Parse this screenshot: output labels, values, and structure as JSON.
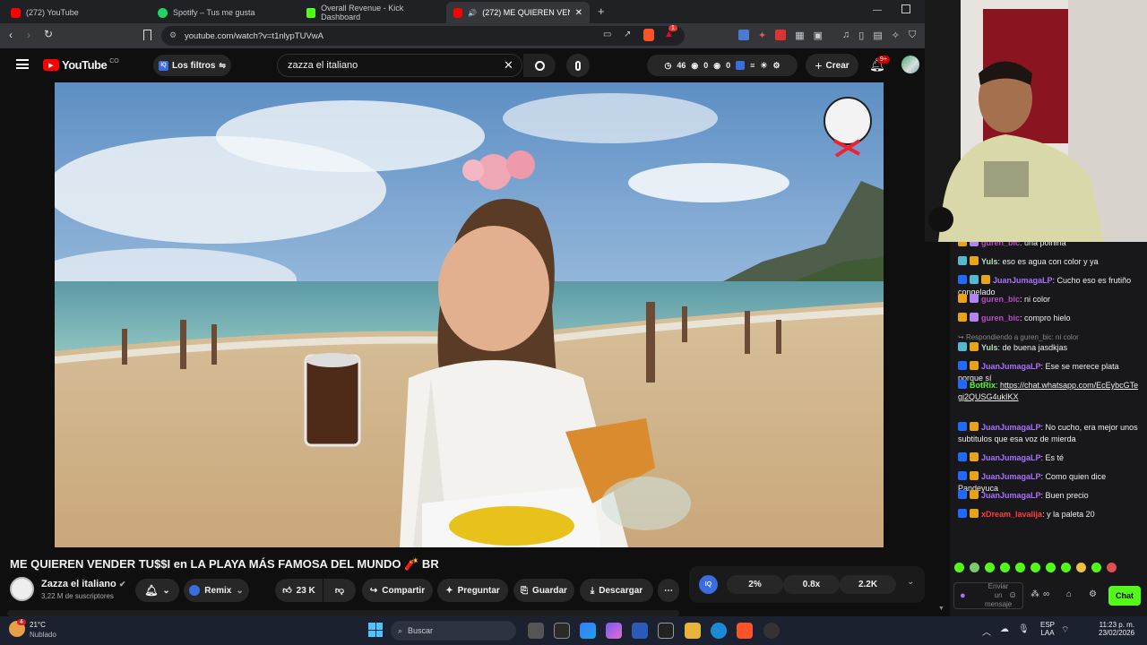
{
  "tabs": [
    {
      "label": "(272) YouTube",
      "color": "#ff0000"
    },
    {
      "label": "Spotify – Tus me gusta",
      "color": "#1ed760"
    },
    {
      "label": "Overall Revenue - Kick Dashboard",
      "color": "#53fc18"
    },
    {
      "label": "(272) ME QUIEREN VENDER T",
      "color": "#ff0000"
    }
  ],
  "url": "youtube.com/watch?v=t1nlypTUVwA",
  "ext_badge": "1",
  "yt": {
    "logo": "YouTube",
    "region": "CO",
    "filters": "Los filtros",
    "search_value": "zazza el italiano",
    "stats": [
      "46",
      "0",
      "0"
    ],
    "create": "Crear",
    "notif_count": "9+"
  },
  "video": {
    "title": "ME QUIEREN VENDER TU$$I en LA PLAYA MÁS FAMOSA DEL MUNDO 🧨 BR",
    "channel": "Zazza el italiano",
    "subs": "3,22 M de suscriptores",
    "remix": "Remix",
    "likes": "23 K",
    "share": "Compartir",
    "ask": "Preguntar",
    "save": "Guardar",
    "download": "Descargar"
  },
  "iq_stats": [
    "2%",
    "0.8x",
    "2.2K"
  ],
  "chat": {
    "messages": [
      {
        "user": "guren_bic",
        "color": "#b84cc8",
        "text": "una polnina",
        "badges": [
          "#e8a317",
          "#b084f6"
        ]
      },
      {
        "user": "Yuls",
        "color": "#b6dfc0",
        "text": "eso es agua con color y ya",
        "badges": [
          "#53b9d1",
          "#e8a317"
        ]
      },
      {
        "user": "JuanJumagaLP",
        "color": "#a970ff",
        "text": "Cucho eso es frutiño congelado",
        "badges": [
          "#1f69ff",
          "#53b9d1",
          "#e8a317"
        ]
      },
      {
        "user": "guren_bic",
        "color": "#b84cc8",
        "text": "ni color",
        "badges": [
          "#e8a317",
          "#b084f6"
        ]
      },
      {
        "user": "guren_bic",
        "color": "#b84cc8",
        "text": "compro hielo",
        "badges": [
          "#e8a317",
          "#b084f6"
        ]
      },
      {
        "reply": "Respondiendo a guren_bic: ni color"
      },
      {
        "user": "Yuls",
        "color": "#b6dfc0",
        "text": "de buena jasdkjas",
        "badges": [
          "#53b9d1",
          "#e8a317"
        ]
      },
      {
        "user": "JuanJumagaLP",
        "color": "#a970ff",
        "text": "Ese se merece plata porque sí",
        "badges": [
          "#1f69ff",
          "#e8a317"
        ]
      },
      {
        "user": "BotRix",
        "color": "#53fc18",
        "text": "https://chat.whatsapp.com/EcEybcGTegj2QUSG4ukIKX",
        "badges": [
          "#1f69ff"
        ]
      },
      {
        "user": "JuanJumagaLP",
        "color": "#a970ff",
        "text": "No cucho, era mejor unos subtitulos que esa voz de mierda",
        "badges": [
          "#1f69ff",
          "#e8a317"
        ]
      },
      {
        "user": "JuanJumagaLP",
        "color": "#a970ff",
        "text": "Es té",
        "badges": [
          "#1f69ff",
          "#e8a317"
        ]
      },
      {
        "user": "JuanJumagaLP",
        "color": "#a970ff",
        "text": "Como quien dice Pandeyuca",
        "badges": [
          "#1f69ff",
          "#e8a317"
        ]
      },
      {
        "user": "JuanJumagaLP",
        "color": "#a970ff",
        "text": "Buen precio",
        "badges": [
          "#1f69ff",
          "#e8a317"
        ]
      },
      {
        "user": "xDream_lavalija",
        "color": "#ff3b3b",
        "text": "y la paleta 20",
        "badges": [
          "#1f69ff",
          "#e8a317"
        ]
      }
    ],
    "input_placeholder": "Enviar un mensaje",
    "send": "Chat"
  },
  "taskbar": {
    "weather_badge": "4",
    "temp": "21°C",
    "weather": "Nublado",
    "search": "Buscar",
    "lang": "ESP",
    "lang2": "LAA",
    "time": "11:23 p. m.",
    "date": "23/02/2026"
  }
}
